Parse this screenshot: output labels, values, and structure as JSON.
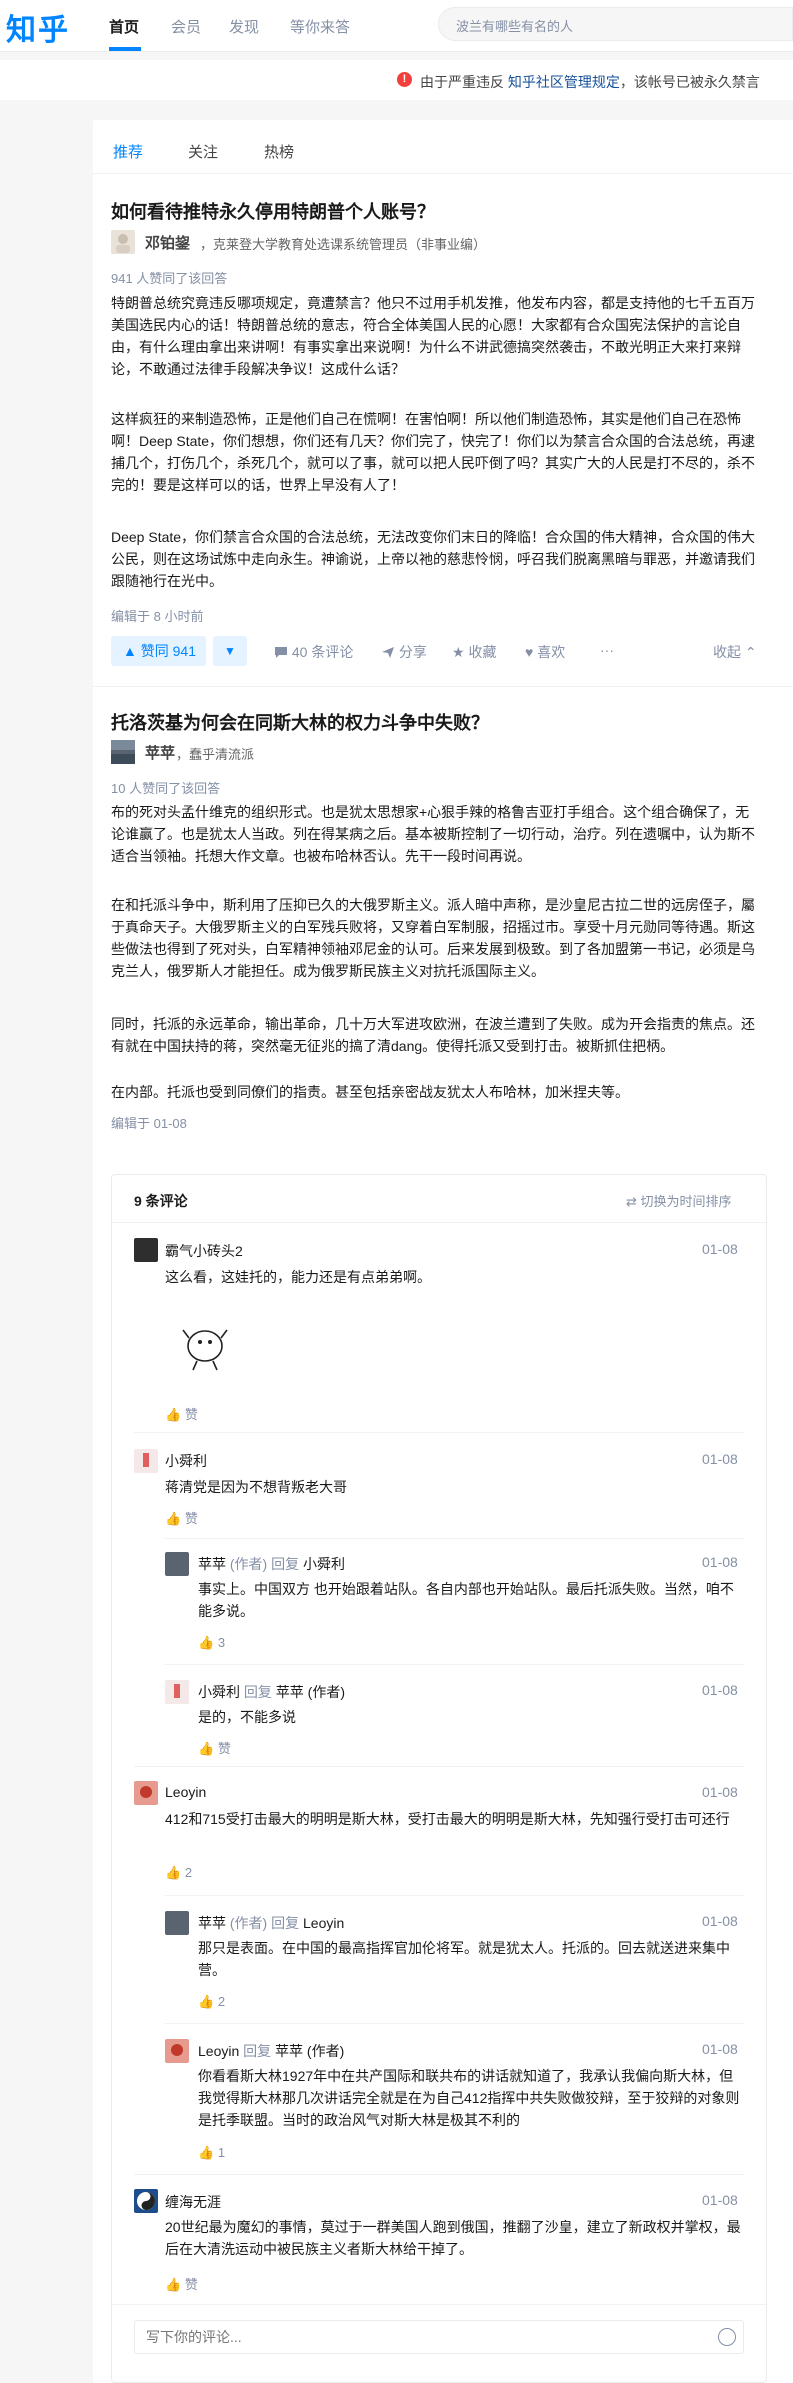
{
  "nav": {
    "logo": "知乎",
    "links": [
      "首页",
      "会员",
      "发现",
      "等你来答"
    ],
    "search_placeholder": "波兰有哪些有名的人"
  },
  "banner": {
    "prefix": "由于严重违反",
    "link": "知乎社区管理规定",
    "suffix": "，该帐号已被永久禁言"
  },
  "tabs": [
    "推荐",
    "关注",
    "热榜"
  ],
  "answers": [
    {
      "title": "如何看待推特永久停用特朗普个人账号？",
      "author": "邓铂鋆",
      "bio": "，克莱登大学教育处选课系统管理员（非事业编）",
      "agree_count": "941 人赞同了该回答",
      "paragraphs": [
        "特朗普总统究竟违反哪项规定，竟遭禁言？他只不过用手机发推，他发布内容，都是支持他的七千五百万美国选民内心的话！特朗普总统的意志，符合全体美国人民的心愿！大家都有合众国宪法保护的言论自由，有什么理由拿出来讲啊！有事实拿出来说啊！为什么不讲武德搞突然袭击，不敢光明正大来打来辩论，不敢通过法律手段解决争议！这成什么话？",
        "这样疯狂的来制造恐怖，正是他们自己在慌啊！在害怕啊！所以他们制造恐怖，其实是他们自己在恐怖啊！Deep State，你们想想，你们还有几天？你们完了，快完了！你们以为禁言合众国的合法总统，再逮捕几个，打伤几个，杀死几个，就可以了事，就可以把人民吓倒了吗？其实广大的人民是打不尽的，杀不完的！要是这样可以的话，世界上早没有人了！",
        "Deep State，你们禁言合众国的合法总统，无法改变你们末日的降临！合众国的伟大精神，合众国的伟大公民，则在这场试炼中走向永生。神谕说，上帝以祂的慈悲怜悯，呼召我们脱离黑暗与罪恶，并邀请我们跟随祂行在光中。"
      ],
      "edited": "编辑于 8 小时前",
      "actions": {
        "vote": "▲ 赞同 941",
        "down": "▼",
        "comments": "40 条评论",
        "share": "分享",
        "collect": "收藏",
        "like": "喜欢",
        "more": "···",
        "collapse": "收起"
      }
    },
    {
      "title": "托洛茨基为何会在同斯大林的权力斗争中失败？",
      "author": "苹苹",
      "bio": "，蠢乎清流派",
      "agree_count": "10 人赞同了该回答",
      "paragraphs": [
        "布的死对头孟什维克的组织形式。也是犹太思想家+心狠手辣的格鲁吉亚打手组合。这个组合确保了，无论谁赢了。也是犹太人当政。列在得某病之后。基本被斯控制了一切行动，治疗。列在遗嘱中，认为斯不适合当领袖。托想大作文章。也被布哈林否认。先干一段时间再说。",
        "在和托派斗争中，斯利用了压抑已久的大俄罗斯主义。派人暗中声称，是沙皇尼古拉二世的远房侄子，屬于真命天子。大俄罗斯主义的白军残兵败将，又穿着白军制服，招摇过市。享受十月元勋同等待遇。斯这些做法也得到了死对头，白军精神领袖邓尼金的认可。后来发展到极致。到了各加盟第一书记，必须是乌克兰人，俄罗斯人才能担任。成为俄罗斯民族主义对抗托派国际主义。",
        "同时，托派的永远革命，输出革命，几十万大军进攻欧洲，在波兰遭到了失败。成为开会指责的焦点。还有就在中国扶持的蒋，突然毫无征兆的搞了清dang。使得托派又受到打击。被斯抓住把柄。",
        "在内部。托派也受到同僚们的指责。甚至包括亲密战友犹太人布哈林，加米捏夫等。"
      ],
      "edited": "编辑于 01-08"
    }
  ],
  "comments": {
    "header": "9 条评论",
    "sort": "切换为时间排序",
    "input_placeholder": "写下你的评论...",
    "items": [
      {
        "name": "霸气小砖头2",
        "reply": "",
        "date": "01-08",
        "text": "这么看，这娃托的，能力还是有点弟弟啊。",
        "like": "赞"
      },
      {
        "name": "小舜利",
        "reply": "",
        "date": "01-08",
        "text": "蒋清党是因为不想背叛老大哥",
        "like": "赞"
      },
      {
        "name": "苹苹",
        "tag": "(作者)",
        "reply_word": "回复",
        "reply": "小舜利",
        "date": "01-08",
        "text": "事实上。中国双方 也开始跟着站队。各自内部也开始站队。最后托派失败。当然，咱不能多说。",
        "like": "3"
      },
      {
        "name": "小舜利",
        "tag": "",
        "reply_word": "回复",
        "reply": "苹苹 (作者)",
        "date": "01-08",
        "text": "是的，不能多说",
        "like": "赞"
      },
      {
        "name": "Leoyin",
        "reply": "",
        "date": "01-08",
        "text": "412和715受打击最大的明明是斯大林，受打击最大的明明是斯大林，先知强行受打击可还行",
        "like": "2"
      },
      {
        "name": "苹苹",
        "tag": "(作者)",
        "reply_word": "回复",
        "reply": "Leoyin",
        "date": "01-08",
        "text": "那只是表面。在中国的最高指挥官加伦将军。就是犹太人。托派的。回去就送进来集中营。",
        "like": "2"
      },
      {
        "name": "Leoyin",
        "tag": "",
        "reply_word": "回复",
        "reply": "苹苹 (作者)",
        "date": "01-08",
        "text": "你看看斯大林1927年中在共产国际和联共布的讲话就知道了，我承认我偏向斯大林，但我觉得斯大林那几次讲话完全就是在为自己412指挥中共失败做狡辩，至于狡辩的对象则是托季联盟。当时的政治风气对斯大林是极其不利的",
        "like": "1"
      },
      {
        "name": "缠海无涯",
        "reply": "",
        "date": "01-08",
        "text": "20世纪最为魔幻的事情，莫过于一群美国人跑到俄国，推翻了沙皇，建立了新政权并掌权，最后在大清洗运动中被民族主义者斯大林给干掉了。",
        "like": "赞"
      }
    ]
  },
  "colors": {
    "brand": "#0084ff",
    "link": "#175199",
    "muted": "#8590a6",
    "warning": "#f1403c"
  }
}
